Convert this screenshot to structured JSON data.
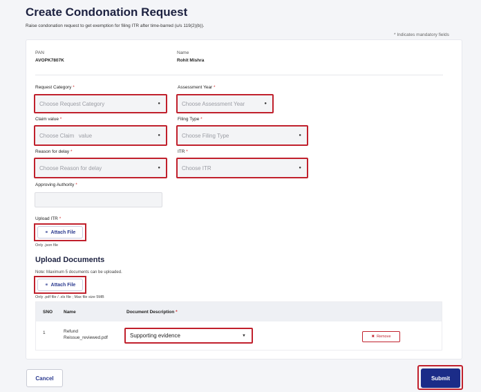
{
  "header": {
    "title": "Create Condonation Request",
    "subtitle": "Raise condonation request to get exemption for filing ITR after time-barred (u/s 119(2)(b)).",
    "mandatory_note": "* Indicates mandatory fields"
  },
  "profile": {
    "pan_label": "PAN",
    "pan_value": "AVOPK7807K",
    "name_label": "Name",
    "name_value": "Rohit Mishra"
  },
  "form": {
    "request_category": {
      "label": "Request Category",
      "placeholder": "Choose Request Category"
    },
    "assessment_year": {
      "label": "Assessment Year",
      "placeholder": "Choose Assessment Year"
    },
    "claim_value": {
      "label": "Claim value",
      "placeholder_part1": "Choose Claim",
      "placeholder_part2": "value"
    },
    "filing_type": {
      "label": "Filing Type",
      "placeholder": "Choose Filing Type"
    },
    "reason_for_delay": {
      "label": "Reason for delay",
      "placeholder": "Choose Reason for delay"
    },
    "itr": {
      "label": "ITR",
      "placeholder": "Choose ITR"
    },
    "approving_authority": {
      "label": "Approving Authority",
      "value": ""
    },
    "required_mark": "*"
  },
  "upload_itr": {
    "label": "Upload ITR",
    "button": "Attach File",
    "hint": "Only .json file"
  },
  "upload_documents": {
    "title": "Upload Documents",
    "note": "Note: Maximum 5 documents can be uploaded.",
    "button": "Attach File",
    "hint": "Only .pdf file / .xls file ; Max file size 5MB"
  },
  "table": {
    "headers": {
      "sno": "SNO",
      "name": "Name",
      "description": "Document Description"
    },
    "rows": [
      {
        "sno": "1",
        "name_line1": "Refund",
        "name_line2": "Reissue_reviewed.pdf",
        "description": "Supporting evidence",
        "remove": "Remove"
      }
    ]
  },
  "footer": {
    "cancel": "Cancel",
    "submit": "Submit"
  },
  "icons": {
    "attach": "paperclip-icon",
    "remove": "remove-circle-icon",
    "dropdown": "caret-down-icon"
  },
  "colors": {
    "accent": "#1b2c88",
    "highlight": "#c01f2b"
  }
}
